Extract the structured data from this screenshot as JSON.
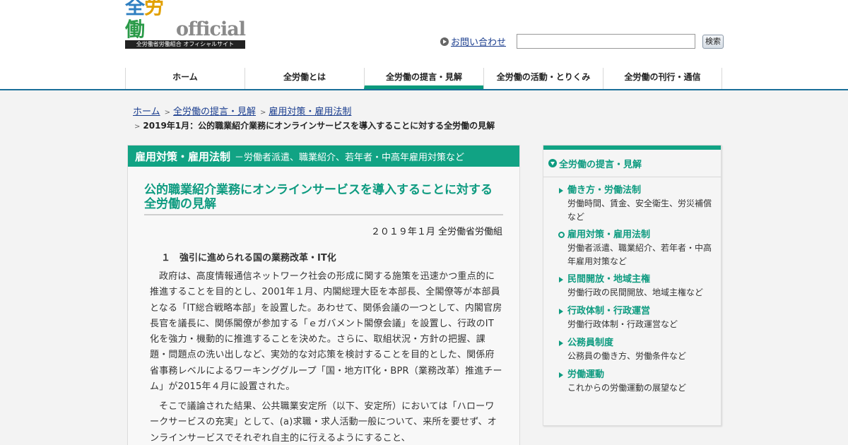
{
  "logo": {
    "kanji": [
      "全",
      "労",
      "働"
    ],
    "official": "official",
    "subtitle": "全労働省労働組合 オフィシャルサイト"
  },
  "header": {
    "contact_label": "お問い合わせ",
    "search_value": "",
    "search_button": "検索"
  },
  "nav": {
    "items": [
      {
        "label": "ホーム"
      },
      {
        "label": "全労働とは"
      },
      {
        "label": "全労働の提言・見解",
        "active": true
      },
      {
        "label": "全労働の活動・とりくみ"
      },
      {
        "label": "全労働の刊行・通信"
      }
    ]
  },
  "breadcrumb": {
    "items": [
      "ホーム",
      "全労働の提言・見解",
      "雇用対策・雇用法制"
    ],
    "current": "2019年1月：公的職業紹介業務にオンラインサービスを導入することに対する全労働の見解"
  },
  "main": {
    "category": "雇用対策・雇用法制",
    "category_sub": "－労働者派遣、職業紹介、若年者・中高年雇用対策など",
    "title": "公的職業紹介業務にオンラインサービスを導入することに対する全労働の見解",
    "date": "２０１９年１月 全労働省労働組",
    "section1": "１　強引に進められる国の業務改革・IT化",
    "para1": "政府は、高度情報通信ネットワーク社会の形成に関する施策を迅速かつ重点的に推進することを目的とし、2001年１月、内閣総理大臣を本部長、全閣僚等が本部員となる「IT総合戦略本部」を設置した。あわせて、関係会議の一つとして、内閣官房長官を議長に、関係閣僚が参加する「ｅガバメント閣僚会議」を設置し、行政のIT化を強力・機動的に推進することを決めた。さらに、取組状況・方針の把握、課題・問題点の洗い出しなど、実効的な対応策を検討することを目的とした、関係府省事務レベルによるワーキンググループ「国・地方IT化・BPR（業務改革）推進チーム」が2015年４月に設置された。",
    "para2": "そこで議論された結果、公共職業安定所（以下、安定所）においては「ハローワークサービスの充実」として、(a)求職・求人活動一般について、来所を要せず、オンラインサービスでそれぞれ自主的に行えるようにすること、"
  },
  "sidebar": {
    "title": "全労働の提言・見解",
    "items": [
      {
        "title": "働き方・労働法制",
        "desc": "労働時間、賃金、安全衛生、労災補償など"
      },
      {
        "title": "雇用対策・雇用法制",
        "desc": "労働者派遣、職業紹介、若年者・中高年雇用対策など",
        "current": true
      },
      {
        "title": "民間開放・地域主権",
        "desc": "労働行政の民間開放、地域主権など"
      },
      {
        "title": "行政体制・行政運営",
        "desc": "労働行政体制・行政運営など"
      },
      {
        "title": "公務員制度",
        "desc": "公務員の働き方、労働条件など"
      },
      {
        "title": "労働運動",
        "desc": "これからの労働運動の展望など"
      }
    ]
  },
  "colors": {
    "accent_green": "#11a384",
    "nav_line_blue": "#1a6f99",
    "link_blue": "#1b3e8f"
  }
}
